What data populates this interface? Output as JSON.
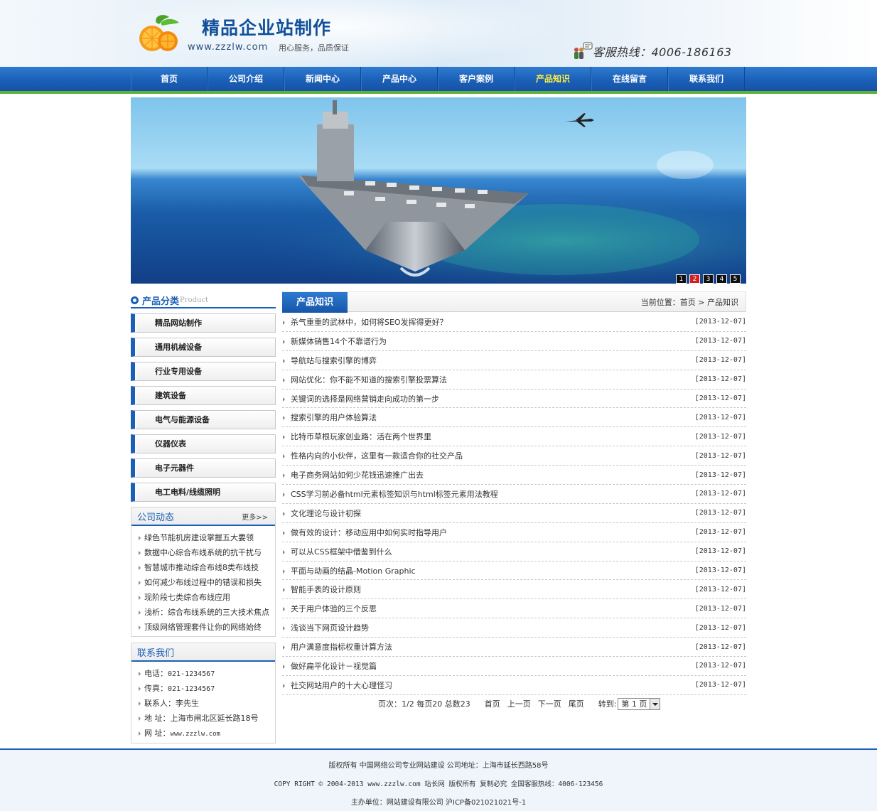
{
  "header": {
    "title": "精品企业站制作",
    "url": "www.zzzlw.com",
    "slogan": "用心服务，品质保证",
    "hotline": "客服热线：4006-186163"
  },
  "nav": {
    "items": [
      {
        "label": "首页"
      },
      {
        "label": "公司介绍"
      },
      {
        "label": "新闻中心"
      },
      {
        "label": "产品中心"
      },
      {
        "label": "客户案例"
      },
      {
        "label": "产品知识",
        "active": true
      },
      {
        "label": "在线留言"
      },
      {
        "label": "联系我们"
      }
    ],
    "active_color": "#ffef3a"
  },
  "banner": {
    "dots": [
      "1",
      "2",
      "3",
      "4",
      "5"
    ],
    "active_dot": "2"
  },
  "sidebar": {
    "category_title": "产品分类",
    "category_title_en": "Product",
    "categories": [
      "精品网站制作",
      "通用机械设备",
      "行业专用设备",
      "建筑设备",
      "电气与能源设备",
      "仪器仪表",
      "电子元器件",
      "电工电料/线缆照明"
    ],
    "news_box": {
      "title": "公司动态",
      "more": "更多>>",
      "items": [
        "绿色节能机房建设掌握五大要领",
        "数据中心综合布线系统的抗干扰与",
        "智慧城市推动综合布线8类布线技",
        "如何减少布线过程中的错误和损失",
        "现阶段七类综合布线应用",
        "浅析：综合布线系统的三大技术焦点",
        "顶级网络管理套件让你的网络始终"
      ]
    },
    "contact_box": {
      "title": "联系我们",
      "items": [
        {
          "label": "电话：",
          "value": "021-1234567"
        },
        {
          "label": "传真：",
          "value": "021-1234567"
        },
        {
          "label": "联系人：",
          "value": "李先生"
        },
        {
          "label": "地 址：",
          "value": "上海市闸北区延长路18号"
        },
        {
          "label": "网 址：",
          "value": "www.zzzlw.com"
        }
      ]
    }
  },
  "main": {
    "tab": "产品知识",
    "breadcrumb": {
      "prefix": "当前位置：",
      "home": "首页",
      "sep": ">",
      "current": "产品知识"
    },
    "news": [
      {
        "title": "杀气重重的武林中，如何将SEO发挥得更好？",
        "date": "[2013-12-07]"
      },
      {
        "title": "新媒体销售14个不靠谱行为",
        "date": "[2013-12-07]"
      },
      {
        "title": "导航站与搜索引擎的博弈",
        "date": "[2013-12-07]"
      },
      {
        "title": "网站优化：你不能不知道的搜索引擎投票算法",
        "date": "[2013-12-07]"
      },
      {
        "title": "关键词的选择是网络营销走向成功的第一步",
        "date": "[2013-12-07]"
      },
      {
        "title": "搜索引擎的用户体验算法",
        "date": "[2013-12-07]"
      },
      {
        "title": "比特币草根玩家创业路：活在两个世界里",
        "date": "[2013-12-07]"
      },
      {
        "title": "性格内向的小伙伴，这里有一款适合你的社交产品",
        "date": "[2013-12-07]"
      },
      {
        "title": "电子商务网站如何少花钱迅速推广出去",
        "date": "[2013-12-07]"
      },
      {
        "title": "CSS学习前必备html元素标签知识与html标签元素用法教程",
        "date": "[2013-12-07]"
      },
      {
        "title": "文化理论与设计初探",
        "date": "[2013-12-07]"
      },
      {
        "title": "做有效的设计：移动应用中如何实时指导用户",
        "date": "[2013-12-07]"
      },
      {
        "title": "可以从CSS框架中借鉴到什么",
        "date": "[2013-12-07]"
      },
      {
        "title": "平面与动画的结晶-Motion Graphic",
        "date": "[2013-12-07]"
      },
      {
        "title": "智能手表的设计原则",
        "date": "[2013-12-07]"
      },
      {
        "title": "关于用户体验的三个反思",
        "date": "[2013-12-07]"
      },
      {
        "title": "浅谈当下网页设计趋势",
        "date": "[2013-12-07]"
      },
      {
        "title": "用户满意度指标权重计算方法",
        "date": "[2013-12-07]"
      },
      {
        "title": "做好扁平化设计－视觉篇",
        "date": "[2013-12-07]"
      },
      {
        "title": "社交网站用户的十大心理怪习",
        "date": "[2013-12-07]"
      }
    ],
    "pager": {
      "info": "页次：1/2 每页20 总数23",
      "first": "首页",
      "prev": "上一页",
      "next": "下一页",
      "last": "尾页",
      "goto": "转到:",
      "select_value": "第 1 页"
    }
  },
  "footer": {
    "line1": "版权所有 中国网络公司专业网站建设 公司地址：上海市延长西路58号",
    "line2": "COPY RIGHT © 2004-2013 www.zzzlw.com 站长网 版权所有 复制必究 全国客服热线：4006-123456",
    "line3": "主办单位：网站建设有限公司 沪ICP备021021021号-1"
  },
  "colors": {
    "brand_blue": "#1b60b8",
    "accent_green": "#5eb13b",
    "banner_active_dot": "#d62020"
  }
}
